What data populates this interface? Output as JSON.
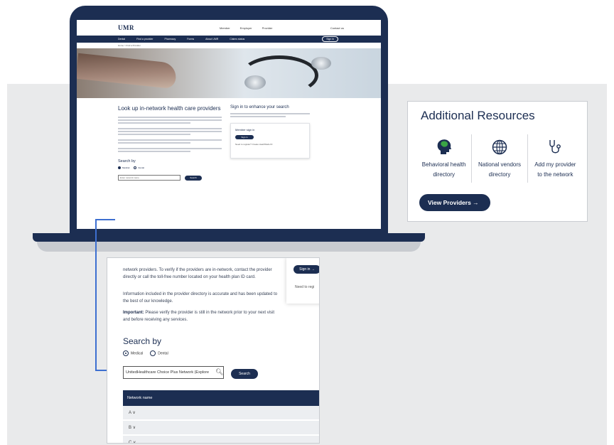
{
  "screen": {
    "logo": "UMR",
    "top_links": [
      "Member",
      "Employer",
      "Provider"
    ],
    "contact": "Contact us",
    "nav": [
      "Dental",
      "Find a provider",
      "Pharmacy",
      "Forms",
      "About UMR",
      "Claims status"
    ],
    "sign_in": "Sign in",
    "breadcrumb": "Home  >  Find a Provider",
    "heading": "Look up in-network health care providers",
    "search_by": "Search by",
    "radios": [
      "Medical",
      "Dental"
    ],
    "input_placeholder": "Enter network name",
    "search_btn": "Search",
    "enhance_heading": "Sign in to enhance your search",
    "member_sign_in": "Member sign in",
    "card_btn": "Sign in",
    "card_link": "Need to register? Create HealthSafe ID"
  },
  "resources": {
    "title": "Additional Resources",
    "items": [
      {
        "label1": "Behavioral health",
        "label2": "directory",
        "icon": "brain-head-icon"
      },
      {
        "label1": "National vendors",
        "label2": "directory",
        "icon": "globe-icon"
      },
      {
        "label1": "Add my provider",
        "label2": "to the network",
        "icon": "stethoscope-icon"
      }
    ],
    "button": "View Providers →"
  },
  "zoom": {
    "para1": "network providers. To verify if the providers are in-network, contact the provider directly or call the toll-free number located on your health plan ID card.",
    "para2": "Information included in the provider directory is accurate and has been updated to the best of our knowledge.",
    "important_label": "Important:",
    "important_text": " Please verify the provider is still in the network prior to your next visit and before receiving any services.",
    "search_by": "Search by",
    "radio_medical": "Medical",
    "radio_dental": "Dental",
    "input_value": "UnitedHealthcare Choice Plus Network (Explore",
    "search_btn": "Search",
    "table_header": "Network name",
    "rows": [
      "A  ∨",
      "B  ∨",
      "C  ∨"
    ],
    "sign_in_btn": "Sign in →",
    "need_text": "Need to regi"
  }
}
